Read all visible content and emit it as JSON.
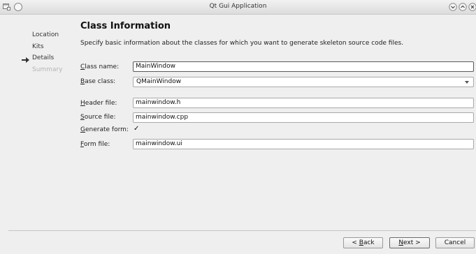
{
  "window": {
    "title": "Qt Gui Application"
  },
  "sidebar": {
    "steps": [
      {
        "label": "Location",
        "state": "done"
      },
      {
        "label": "Kits",
        "state": "done"
      },
      {
        "label": "Details",
        "state": "current"
      },
      {
        "label": "Summary",
        "state": "pending"
      }
    ]
  },
  "page": {
    "heading": "Class Information",
    "description": "Specify basic information about the classes for which you want to generate skeleton source code files."
  },
  "form": {
    "class_name": {
      "label_accel": "C",
      "label_rest": "lass name:",
      "value": "MainWindow"
    },
    "base_class": {
      "label_accel": "B",
      "label_rest": "ase class:",
      "value": "QMainWindow"
    },
    "header_file": {
      "label_accel": "H",
      "label_rest": "eader file:",
      "value": "mainwindow.h"
    },
    "source_file": {
      "label_accel": "S",
      "label_rest": "ource file:",
      "value": "mainwindow.cpp"
    },
    "generate_form": {
      "label_accel": "G",
      "label_rest": "enerate form:",
      "checked_glyph": "✓"
    },
    "form_file": {
      "label_accel": "F",
      "label_rest": "orm file:",
      "value": "mainwindow.ui"
    }
  },
  "buttons": {
    "back": {
      "pre": "< ",
      "accel": "B",
      "rest": "ack"
    },
    "next": {
      "accel": "N",
      "rest": "ext >"
    },
    "cancel": {
      "label": "Cancel"
    }
  },
  "icons": {
    "title_left": "window-menu-icon",
    "title_minimize": "minimize-icon",
    "title_maximize": "maximize-icon",
    "current_step": "arrow-right-icon"
  }
}
